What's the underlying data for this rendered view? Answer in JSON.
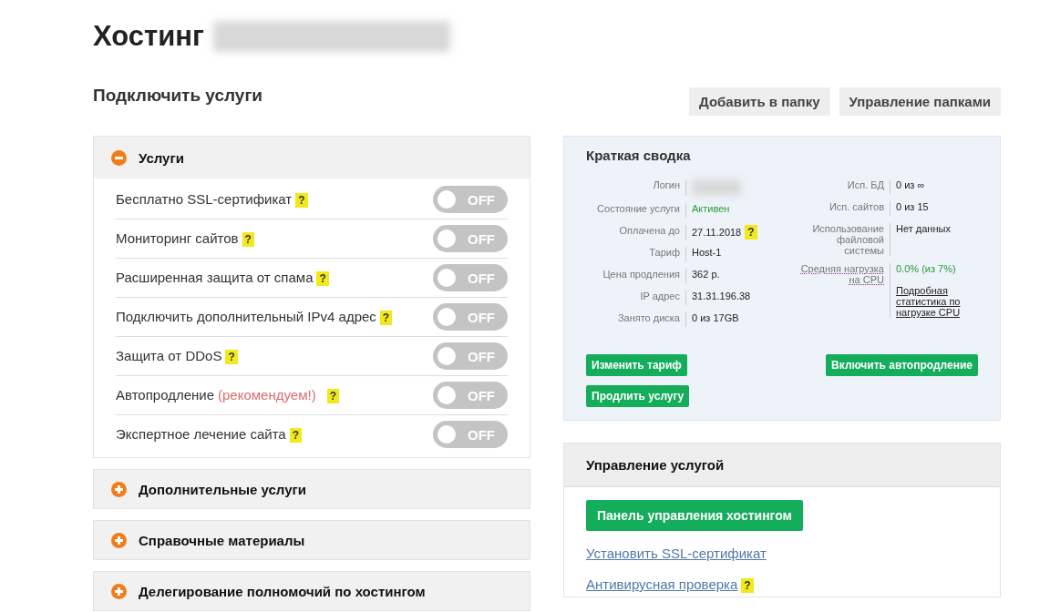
{
  "page": {
    "title": "Хостинг",
    "subtitle": "Подключить услуги"
  },
  "top_buttons": [
    "Добавить в папку",
    "Управление папками"
  ],
  "accordions": [
    {
      "title": "Услуги",
      "expanded": true,
      "items": [
        {
          "label": "Бесплатно SSL-сертификат",
          "help": "?",
          "toggle": {
            "on": false,
            "text": "OFF"
          }
        },
        {
          "label": "Мониторинг сайтов",
          "help": "?",
          "toggle": {
            "on": false,
            "text": "OFF"
          }
        },
        {
          "label": "Расширенная защита от спама",
          "help": "?",
          "toggle": {
            "on": false,
            "text": "OFF"
          }
        },
        {
          "label": "Подключить дополнительный IPv4 адрес",
          "help": "?",
          "toggle": {
            "on": false,
            "text": "OFF"
          }
        },
        {
          "label": "Защита от DDoS",
          "help": "?",
          "toggle": {
            "on": false,
            "text": "OFF"
          }
        },
        {
          "label": "Автопродление",
          "note": "(рекомендуем!)",
          "help": "?",
          "toggle": {
            "on": false,
            "text": "OFF"
          }
        },
        {
          "label": "Экспертное лечение сайта",
          "help": "?",
          "toggle": {
            "on": false,
            "text": "OFF"
          }
        }
      ]
    },
    {
      "title": "Дополнительные услуги",
      "expanded": false
    },
    {
      "title": "Справочные материалы",
      "expanded": false
    },
    {
      "title": "Делегирование полномочий по хостингом",
      "expanded": false
    }
  ],
  "summary": {
    "title": "Краткая сводка",
    "left": [
      {
        "label": "Логин",
        "kind": "redacted"
      },
      {
        "label": "Состояние услуги",
        "value": "Активен",
        "kind": "status"
      },
      {
        "label": "Оплачена до",
        "value": "27.11.2018",
        "help": "?",
        "kind": "text"
      },
      {
        "label": "Тариф",
        "value": "Host-1",
        "kind": "text"
      },
      {
        "label": "Цена продления",
        "value": "362 р.",
        "kind": "text"
      },
      {
        "label": "IP адрес",
        "value": "31.31.196.38",
        "kind": "text"
      },
      {
        "label": "Занято диска",
        "value": "0 из 17GB",
        "kind": "text"
      }
    ],
    "right": [
      {
        "label": "Исп. БД",
        "value": "0 из ∞",
        "kind": "text"
      },
      {
        "label": "Исп. сайтов",
        "value": "0 из 15",
        "kind": "text"
      },
      {
        "label": "Использование файловой системы",
        "value": "Нет данных",
        "kind": "text"
      },
      {
        "label": "Средняя нагрузка на CPU",
        "value": "0.0% (из 7%)",
        "link": "Подробная статистика по нагрузке CPU",
        "kind": "load"
      }
    ],
    "buttons": [
      "Изменить тариф",
      "Включить автопродление",
      "Продлить услугу"
    ]
  },
  "management": {
    "title": "Управление услугой",
    "primary": "Панель управления хостингом",
    "links": [
      {
        "text": "Установить SSL-сертификат"
      },
      {
        "text": "Антивирусная проверка",
        "help": "?"
      }
    ]
  }
}
